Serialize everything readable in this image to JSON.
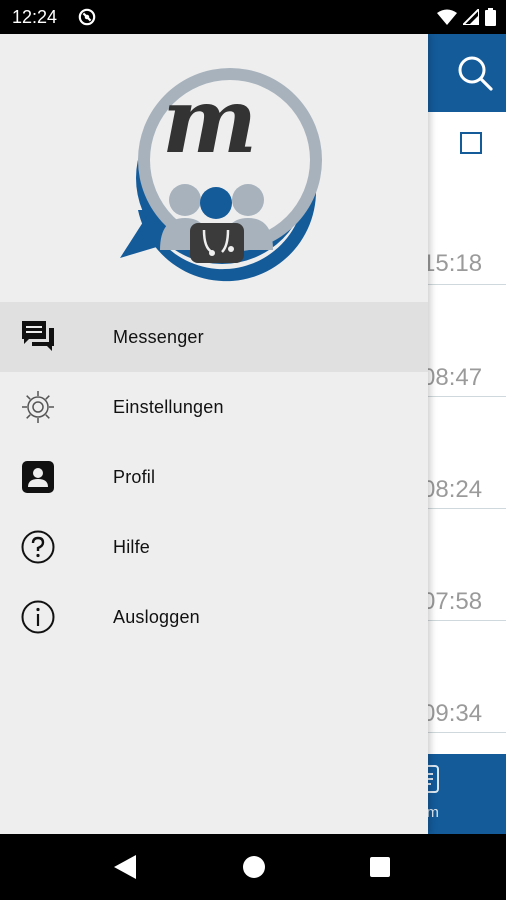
{
  "status_bar": {
    "time": "12:24",
    "icons": [
      "app-notification-icon",
      "wifi-icon",
      "cell-signal-icon",
      "battery-icon"
    ]
  },
  "background_app": {
    "colors": {
      "primary": "#145b9a"
    },
    "times": [
      "15:18",
      "08:47",
      "08:24",
      "07:58",
      "09:34"
    ],
    "bottom_label_partial": "om"
  },
  "drawer": {
    "logo_letter": "m",
    "menu": [
      {
        "label": "Messenger",
        "icon": "chat-bubbles-icon",
        "active": true
      },
      {
        "label": "Einstellungen",
        "icon": "gear-icon",
        "active": false
      },
      {
        "label": "Profil",
        "icon": "profile-icon",
        "active": false
      },
      {
        "label": "Hilfe",
        "icon": "help-icon",
        "active": false
      },
      {
        "label": "Ausloggen",
        "icon": "info-icon",
        "active": false
      }
    ]
  }
}
